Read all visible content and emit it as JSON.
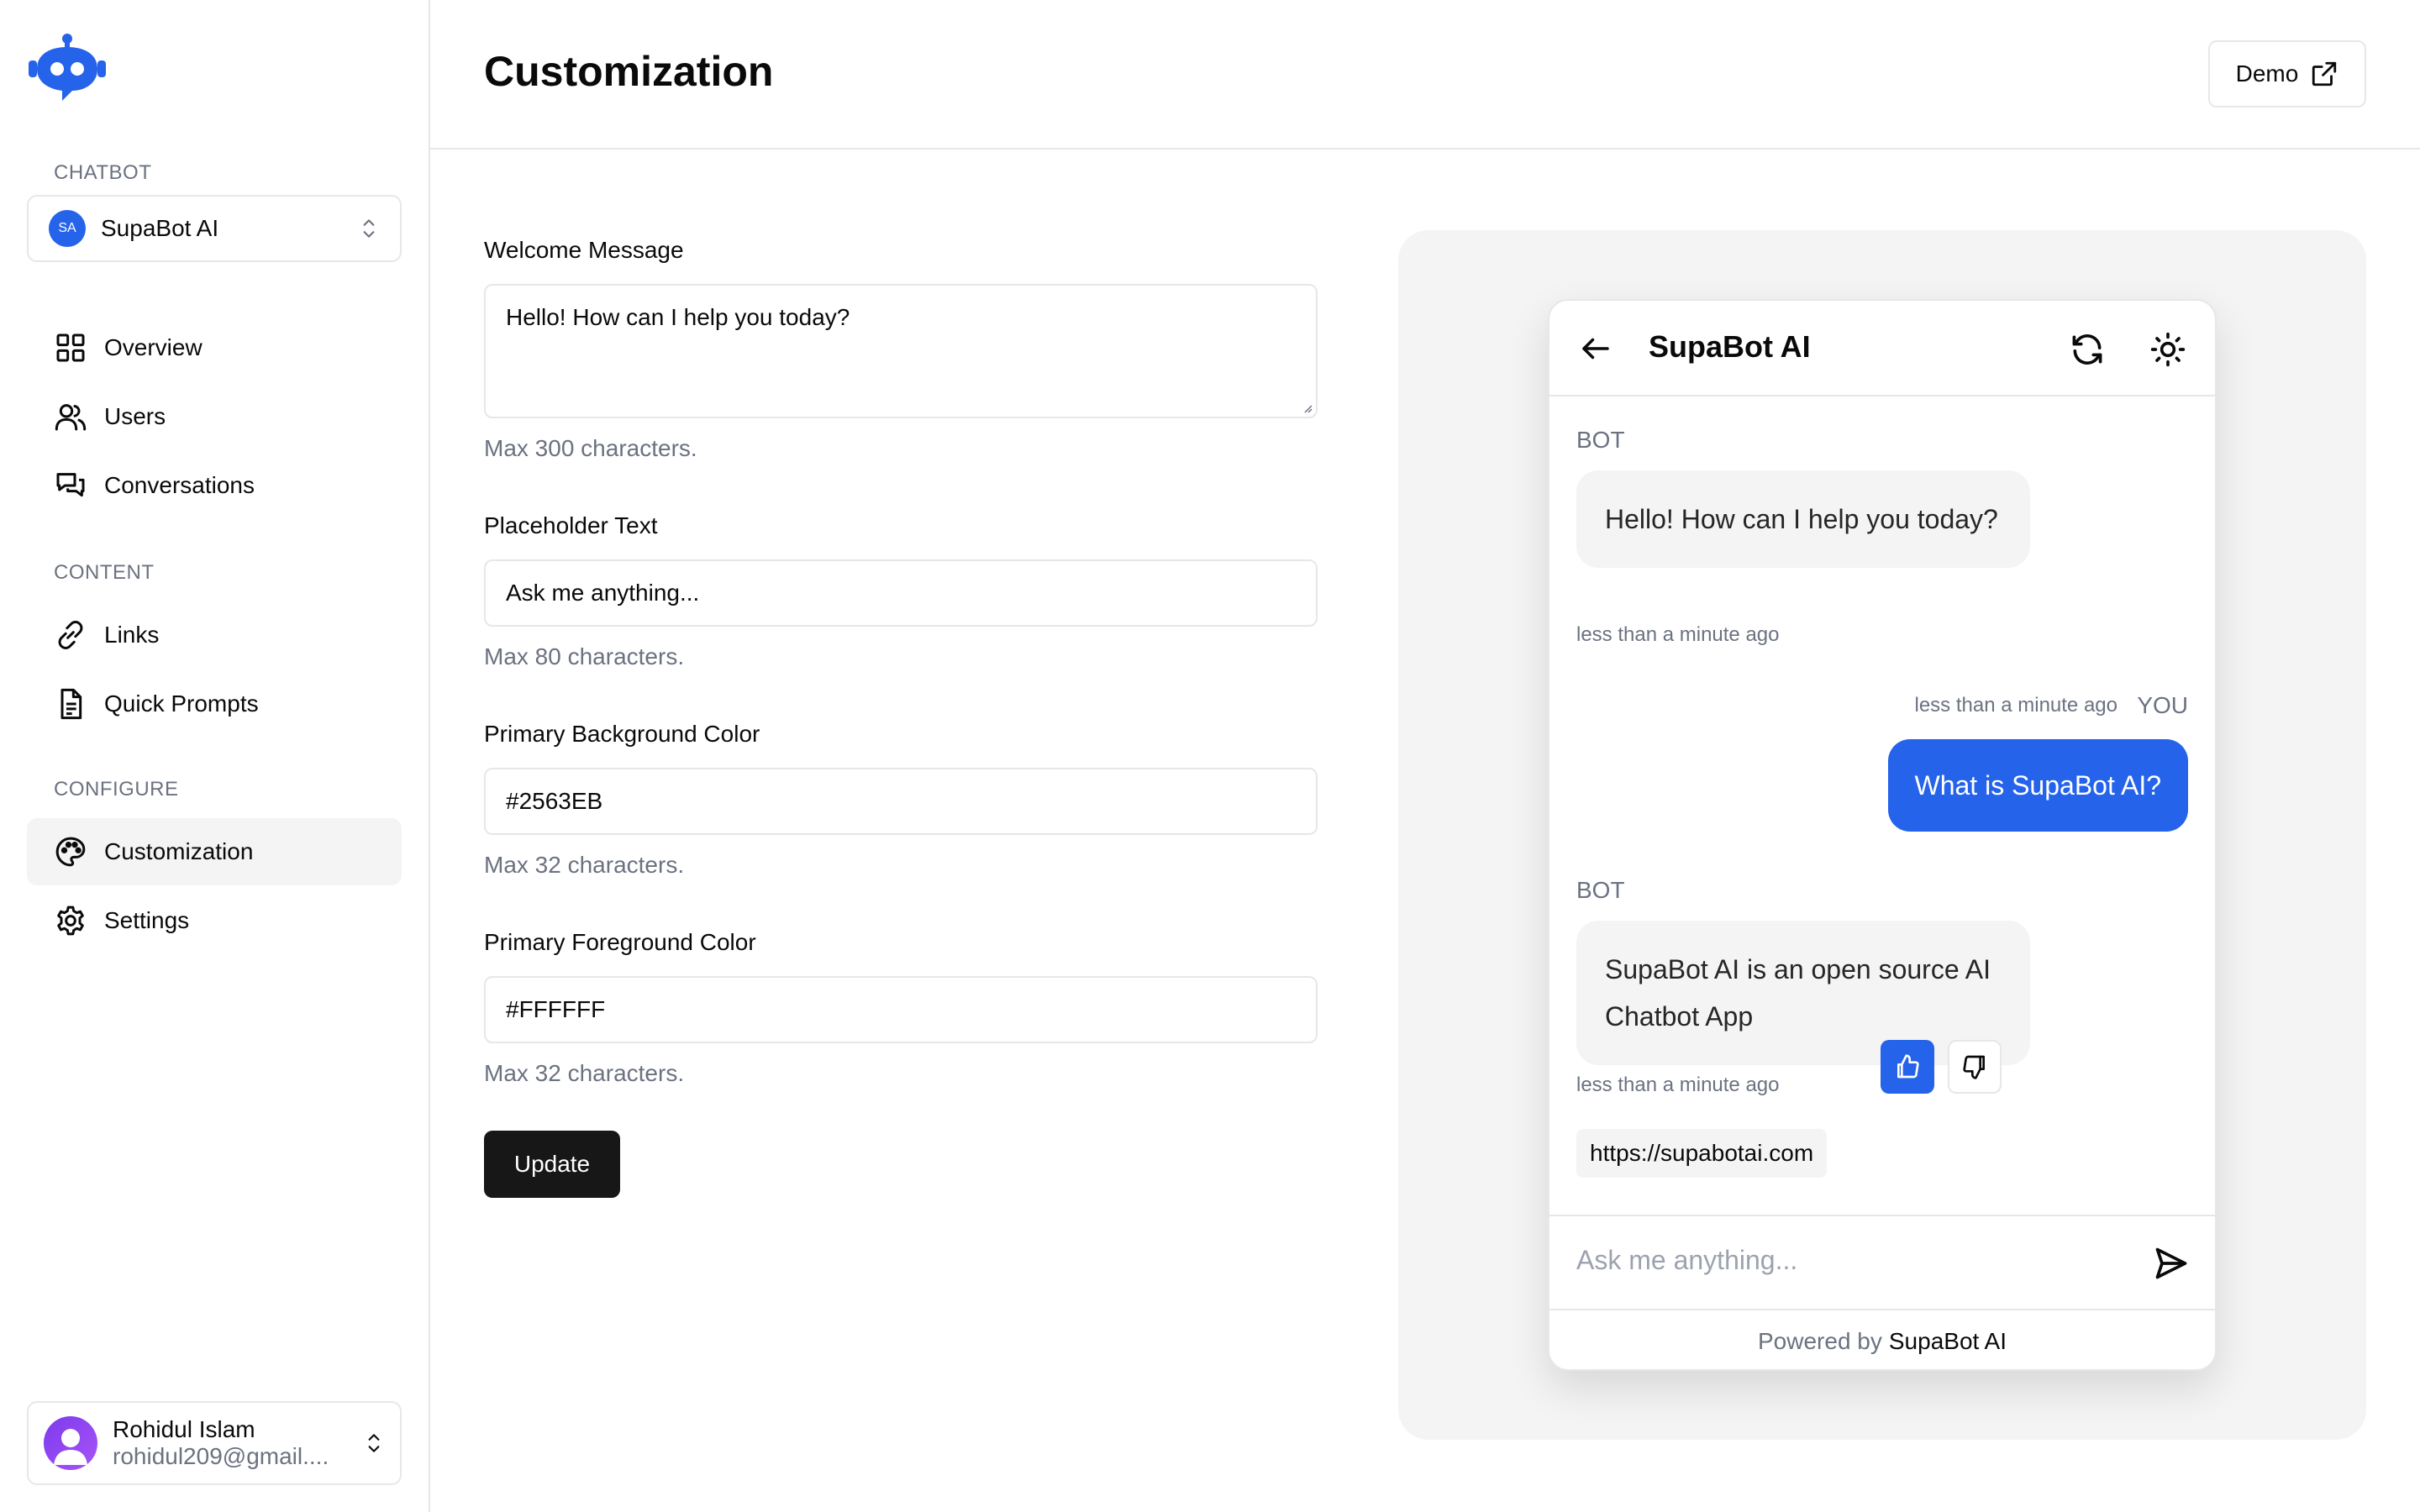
{
  "sidebar": {
    "chatbot_label": "CHATBOT",
    "bot_select": {
      "initials": "SA",
      "name": "SupaBot AI"
    },
    "nav_main": [
      {
        "label": "Overview",
        "icon": "grid-icon"
      },
      {
        "label": "Users",
        "icon": "users-icon"
      },
      {
        "label": "Conversations",
        "icon": "conversations-icon"
      }
    ],
    "content_label": "CONTENT",
    "nav_content": [
      {
        "label": "Links",
        "icon": "link-icon"
      },
      {
        "label": "Quick Prompts",
        "icon": "document-icon"
      }
    ],
    "configure_label": "CONFIGURE",
    "nav_configure": [
      {
        "label": "Customization",
        "icon": "palette-icon",
        "active": true
      },
      {
        "label": "Settings",
        "icon": "gear-icon"
      }
    ],
    "user": {
      "name": "Rohidul Islam",
      "email": "rohidul209@gmail...."
    }
  },
  "header": {
    "title": "Customization",
    "demo_label": "Demo"
  },
  "form": {
    "welcome": {
      "label": "Welcome Message",
      "value": "Hello! How can I help you today?",
      "help": "Max 300 characters."
    },
    "placeholder": {
      "label": "Placeholder Text",
      "value": "Ask me anything...",
      "help": "Max 80 characters."
    },
    "bg_color": {
      "label": "Primary Background Color",
      "value": "#2563EB",
      "help": "Max 32 characters."
    },
    "fg_color": {
      "label": "Primary Foreground Color",
      "value": "#FFFFFF",
      "help": "Max 32 characters."
    },
    "update_label": "Update"
  },
  "preview": {
    "title": "SupaBot AI",
    "messages": [
      {
        "role": "BOT",
        "text": "Hello! How can I help you today?",
        "time": "less than a minute ago"
      },
      {
        "role": "YOU",
        "text": "What is SupaBot AI?",
        "time": "less than a minute ago"
      },
      {
        "role": "BOT",
        "text": "SupaBot AI is an open source AI Chatbot App",
        "time": "less than a minute ago"
      }
    ],
    "link": "https://supabotai.com",
    "input_placeholder": "Ask me anything...",
    "powered_prefix": "Powered by",
    "powered_brand": "SupaBot AI"
  },
  "colors": {
    "accent": "#2563EB",
    "accent_foreground": "#FFFFFF",
    "button_dark": "#171717",
    "muted": "#F4F4F5"
  }
}
